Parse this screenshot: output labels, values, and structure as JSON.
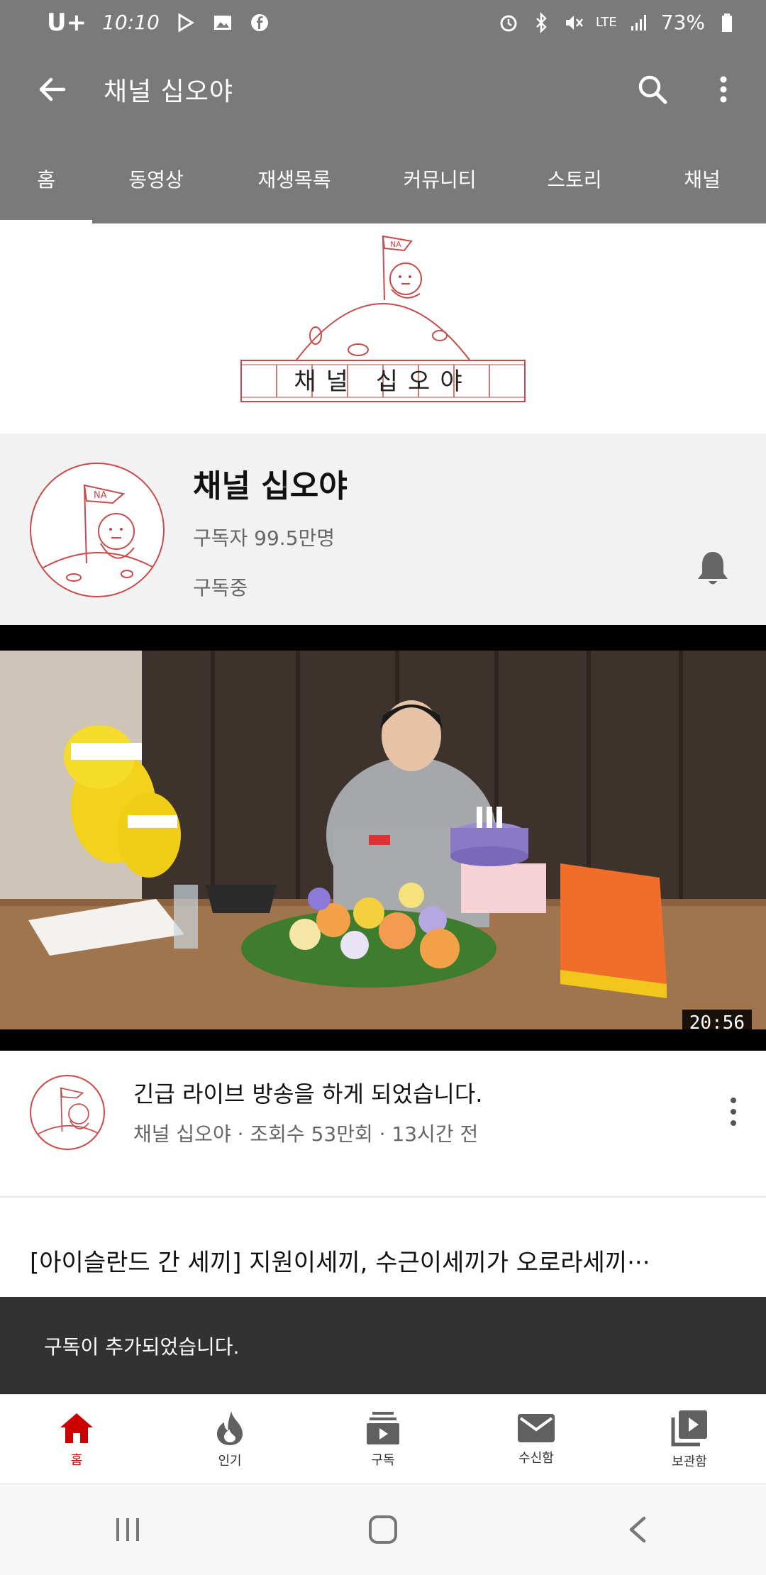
{
  "status_bar": {
    "carrier": "U+",
    "time": "10:10",
    "network": "LTE",
    "battery": "73%",
    "left_icons": [
      "play-store-icon",
      "gallery-icon",
      "facebook-icon"
    ],
    "right_icons": [
      "alarm-icon",
      "bluetooth-icon",
      "mute-icon",
      "signal-icon",
      "battery-icon"
    ]
  },
  "app_bar": {
    "title": "채널 십오야",
    "actions": [
      "search-icon",
      "more-vert-icon"
    ]
  },
  "tabs": [
    {
      "label": "홈",
      "active": true
    },
    {
      "label": "동영상",
      "active": false
    },
    {
      "label": "재생목록",
      "active": false
    },
    {
      "label": "커뮤니티",
      "active": false
    },
    {
      "label": "스토리",
      "active": false
    },
    {
      "label": "채널",
      "active": false
    }
  ],
  "banner": {
    "logo_text": "채널 십오야",
    "flag_text": "NA"
  },
  "channel": {
    "name": "채널 십오야",
    "subscribers": "구독자 99.5만명",
    "status": "구독중"
  },
  "video": {
    "duration": "20:56",
    "title": "긴급 라이브 방송을 하게 되었습니다.",
    "meta": "채널 십오야 · 조회수 53만회 · 13시간 전"
  },
  "next_video": {
    "title": "[아이슬란드 간 세끼] 지원이세끼, 수근이세끼가 오로라세끼···"
  },
  "snackbar": {
    "message": "구독이 추가되었습니다."
  },
  "bottom_nav": [
    {
      "label": "홈",
      "icon": "home-icon",
      "active": true
    },
    {
      "label": "인기",
      "icon": "trending-icon",
      "active": false
    },
    {
      "label": "구독",
      "icon": "subscriptions-icon",
      "active": false
    },
    {
      "label": "수신함",
      "icon": "inbox-icon",
      "active": false
    },
    {
      "label": "보관함",
      "icon": "library-icon",
      "active": false
    }
  ],
  "colors": {
    "header_bg": "#7a7a7a",
    "accent": "#cc0000",
    "logo_line": "#c94a4a",
    "snackbar_bg": "#323232"
  }
}
